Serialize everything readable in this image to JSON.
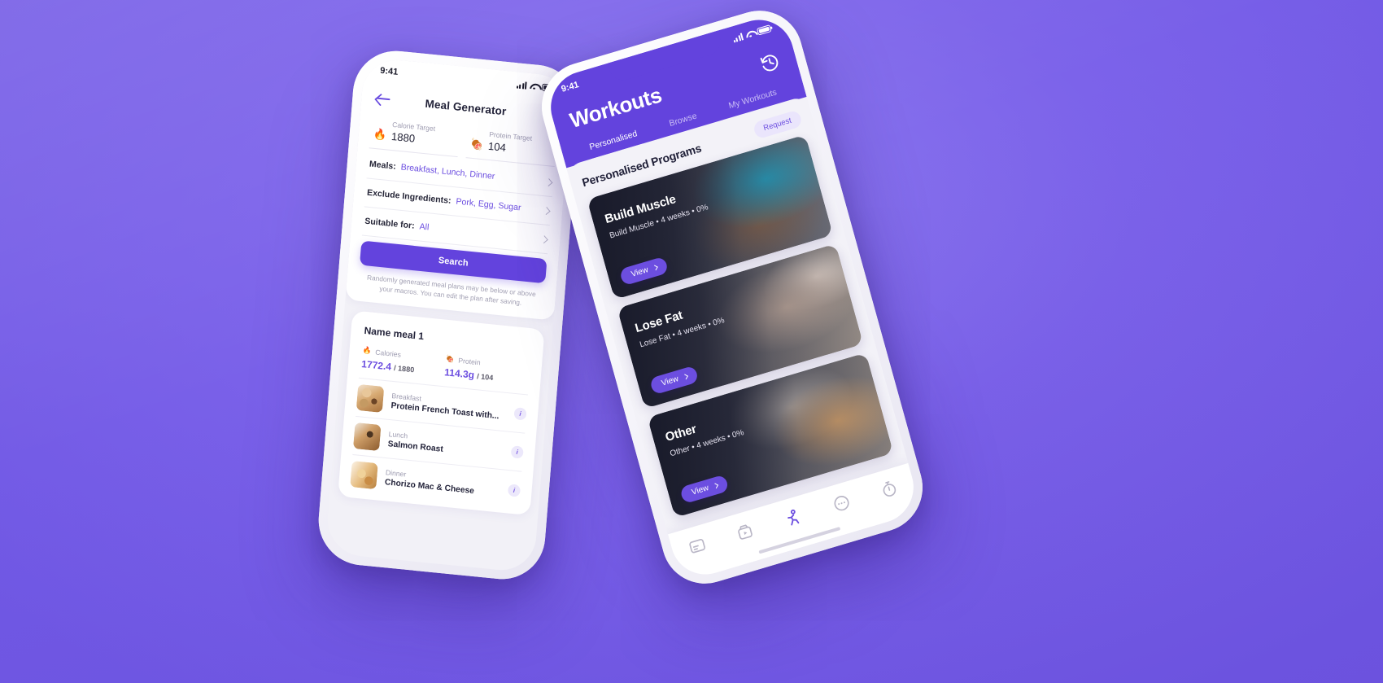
{
  "meta": {
    "accent": "#6343dd",
    "accent_light": "#6c4ee0",
    "chip_bg": "#eae5fc"
  },
  "left_phone": {
    "status_bar": {
      "time": "9:41",
      "signal_icon": "cellular-bars-icon",
      "wifi_icon": "wifi-icon",
      "battery_icon": "battery-icon"
    },
    "nav": {
      "back_icon": "back-arrow-icon",
      "title": "Meal Generator"
    },
    "targets": [
      {
        "icon": "fire-emoji",
        "glyph": "🔥",
        "label": "Calorie Target",
        "value": "1880"
      },
      {
        "icon": "meat-emoji",
        "glyph": "🍖",
        "label": "Protein Target",
        "value": "104"
      }
    ],
    "filters": [
      {
        "label": "Meals:",
        "value": "Breakfast, Lunch, Dinner",
        "chevron": "chevron-right-icon"
      },
      {
        "label": "Exclude Ingredients:",
        "value": "Pork, Egg, Sugar",
        "chevron": "chevron-right-icon"
      },
      {
        "label": "Suitable for:",
        "value": "All",
        "chevron": "chevron-right-icon"
      }
    ],
    "search_button": "Search",
    "hint": "Randomly generated meal plans may be below or above your macros. You can edit the plan after saving.",
    "result": {
      "name": "Name meal 1",
      "macros": [
        {
          "icon": "fire-emoji",
          "glyph": "🔥",
          "label": "Calories",
          "value": "1772.4",
          "target": "/ 1880"
        },
        {
          "icon": "meat-emoji",
          "glyph": "🍖",
          "label": "Protein",
          "value": "114.3g",
          "target": "/ 104"
        }
      ],
      "items": [
        {
          "category": "Breakfast",
          "name": "Protein French Toast with...",
          "info_icon": "info-icon",
          "info_label": "i"
        },
        {
          "category": "Lunch",
          "name": "Salmon Roast",
          "info_icon": "info-icon",
          "info_label": "i"
        },
        {
          "category": "Dinner",
          "name": "Chorizo Mac & Cheese",
          "info_icon": "info-icon",
          "info_label": "i"
        }
      ]
    }
  },
  "right_phone": {
    "status_bar": {
      "time": "9:41",
      "signal_icon": "cellular-bars-icon",
      "wifi_icon": "wifi-icon",
      "battery_icon": "battery-icon"
    },
    "header": {
      "title": "Workouts",
      "history_icon": "history-clock-icon"
    },
    "tabs": [
      {
        "label": "Personalised",
        "active": true
      },
      {
        "label": "Browse",
        "active": false
      },
      {
        "label": "My Workouts",
        "active": false
      }
    ],
    "section": {
      "title": "Personalised Programs",
      "request_button": "Request"
    },
    "programs": [
      {
        "title": "Build Muscle",
        "meta": "Build Muscle • 4 weeks • 0%",
        "button": "View",
        "button_icon": "chevron-right-icon"
      },
      {
        "title": "Lose Fat",
        "meta": "Lose Fat • 4 weeks • 0%",
        "button": "View",
        "button_icon": "chevron-right-icon"
      },
      {
        "title": "Other",
        "meta": "Other • 4 weeks • 0%",
        "button": "View",
        "button_icon": "chevron-right-icon"
      }
    ],
    "tabbar": [
      {
        "icon": "article-icon",
        "active": false
      },
      {
        "icon": "video-play-icon",
        "active": false
      },
      {
        "icon": "running-person-icon",
        "active": true
      },
      {
        "icon": "more-dots-icon",
        "active": false
      },
      {
        "icon": "stopwatch-icon",
        "active": false
      }
    ]
  }
}
